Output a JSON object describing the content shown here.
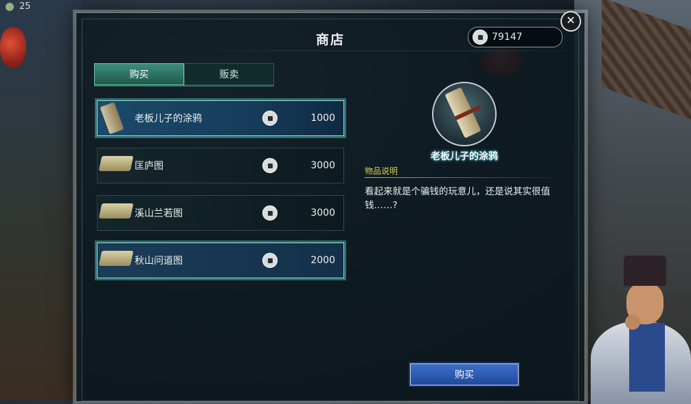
{
  "hud": {
    "top_value": "25"
  },
  "shop": {
    "title": "商店",
    "money": "79147",
    "tabs": [
      {
        "label": "购买",
        "active": true
      },
      {
        "label": "贩卖",
        "active": false
      }
    ],
    "items": [
      {
        "name": "老板儿子的涂鸦",
        "price": "1000",
        "state": "selected",
        "icon": "scroll-icon"
      },
      {
        "name": "匡庐图",
        "price": "3000",
        "state": "normal",
        "icon": "painting-scroll-icon"
      },
      {
        "name": "溪山兰若图",
        "price": "3000",
        "state": "normal",
        "icon": "painting-scroll-icon"
      },
      {
        "name": "秋山问道图",
        "price": "2000",
        "state": "highlight",
        "icon": "painting-scroll-icon"
      }
    ],
    "detail": {
      "name": "老板儿子的涂鸦",
      "desc_label": "物品说明",
      "description": "看起来就是个骗钱的玩意儿，还是说其实很值钱……?"
    },
    "buy_button": "购买"
  }
}
